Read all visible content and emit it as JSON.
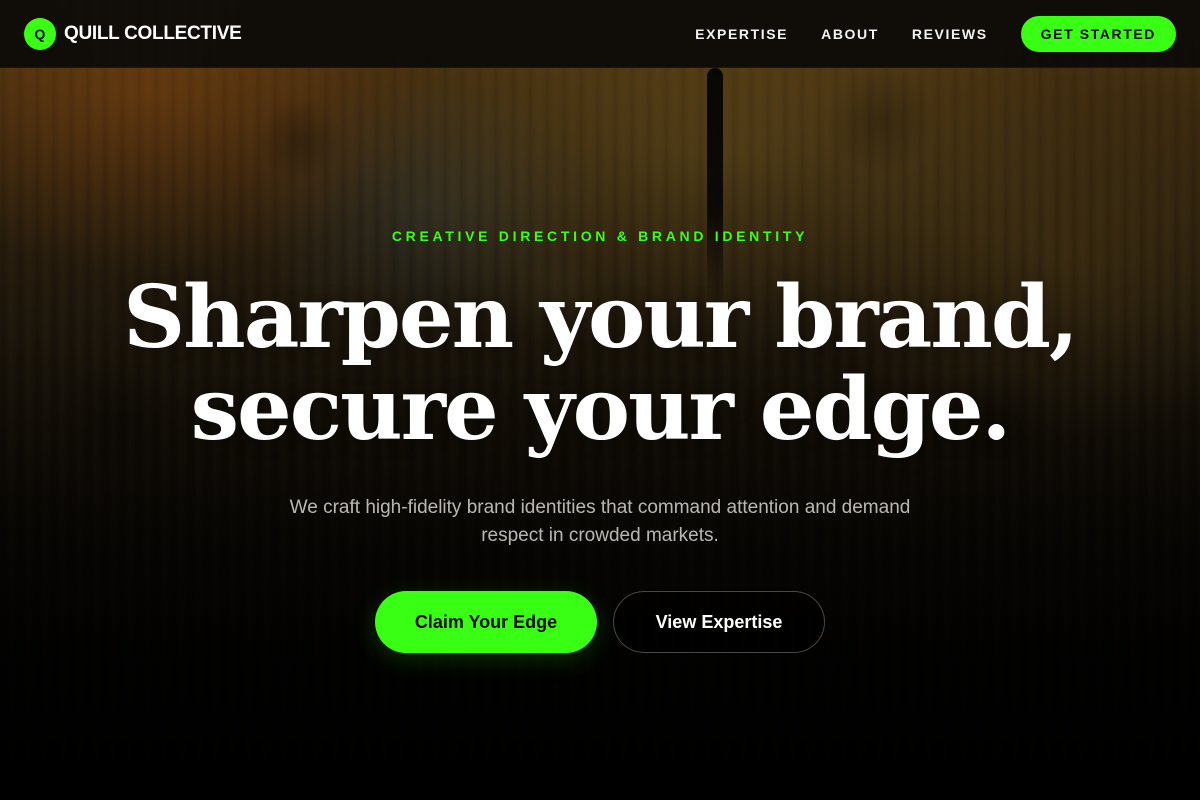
{
  "colors": {
    "accent": "#39ff14",
    "nav_background": "#0e0b08",
    "text_primary": "#ffffff"
  },
  "brand": {
    "mark": "Q",
    "name": "QUILL COLLECTIVE"
  },
  "nav": {
    "links": [
      {
        "label": "EXPERTISE"
      },
      {
        "label": "ABOUT"
      },
      {
        "label": "REVIEWS"
      }
    ],
    "cta_label": "GET STARTED"
  },
  "hero": {
    "eyebrow": "CREATIVE DIRECTION & BRAND IDENTITY",
    "headline_line1": "Sharpen your brand,",
    "headline_line2": "secure your edge.",
    "subtitle": "We craft high-fidelity brand identities that command attention and demand respect in crowded markets.",
    "primary_button": "Claim Your Edge",
    "secondary_button": "View Expertise"
  }
}
